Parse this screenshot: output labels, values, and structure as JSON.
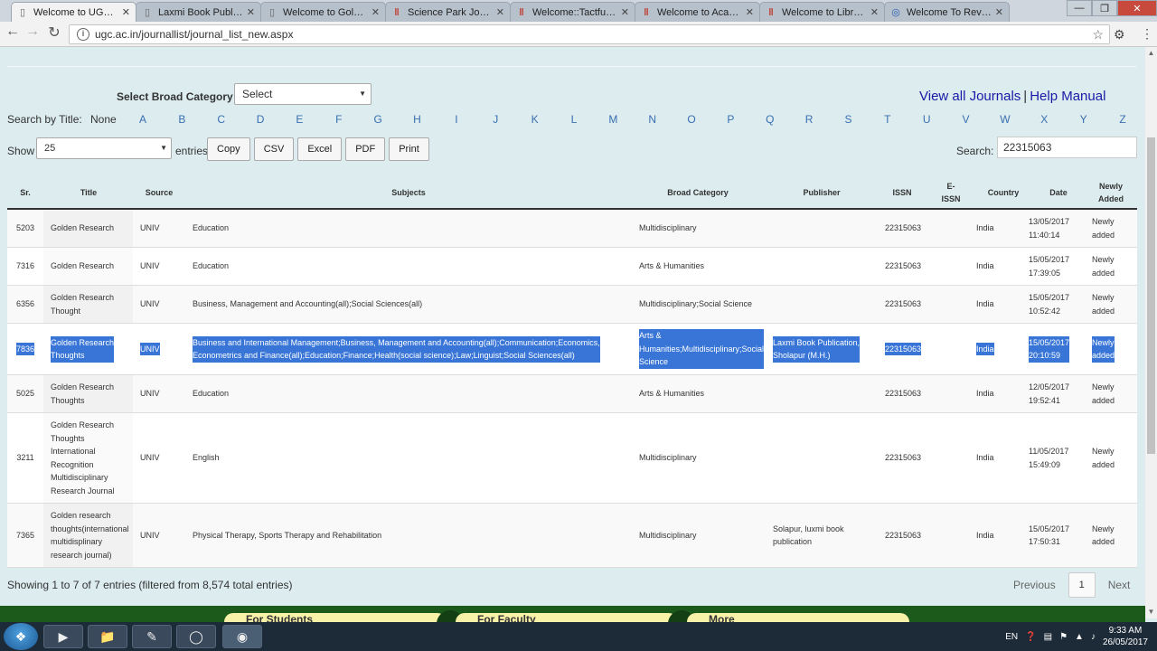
{
  "browser": {
    "tabs": [
      {
        "title": "Welcome to UGC, Ne",
        "favicon": "page-icon",
        "active": true
      },
      {
        "title": "Laxmi Book Publicatio",
        "favicon": "page-icon",
        "active": false
      },
      {
        "title": "Welcome to Golden F",
        "favicon": "page-icon",
        "active": false
      },
      {
        "title": "Science Park Journal",
        "favicon": "bars-icon",
        "active": false
      },
      {
        "title": "Welcome::Tactful Ma",
        "favicon": "bars-icon",
        "active": false
      },
      {
        "title": "Welcome to Academ",
        "favicon": "bars-icon",
        "active": false
      },
      {
        "title": "Welcome to Library S",
        "favicon": "bars-icon",
        "active": false
      },
      {
        "title": "Welcome To Review",
        "favicon": "globe-icon",
        "active": false
      }
    ],
    "url": "ugc.ac.in/journallist/journal_list_new.aspx"
  },
  "filters": {
    "category_label": "Select Broad Category :",
    "category_value": "Select",
    "view_all": "View all Journals",
    "separator": "|",
    "help": "Help Manual",
    "search_by_title": "Search by Title:",
    "none": "None",
    "letters": [
      "A",
      "B",
      "C",
      "D",
      "E",
      "F",
      "G",
      "H",
      "I",
      "J",
      "K",
      "L",
      "M",
      "N",
      "O",
      "P",
      "Q",
      "R",
      "S",
      "T",
      "U",
      "V",
      "W",
      "X",
      "Y",
      "Z"
    ]
  },
  "controls": {
    "show_label": "Show",
    "show_value": "25",
    "entries_label": "entries",
    "buttons": [
      "Copy",
      "CSV",
      "Excel",
      "PDF",
      "Print"
    ],
    "search_label": "Search:",
    "search_value": "22315063"
  },
  "table": {
    "headers": [
      "Sr.",
      "Title",
      "Source",
      "Subjects",
      "Broad Category",
      "Publisher",
      "ISSN",
      "E-\nISSN",
      "Country",
      "Date",
      "Newly\nAdded"
    ],
    "rows": [
      {
        "sr": "5203",
        "title": "Golden Research",
        "source": "UNIV",
        "subjects": "Education",
        "category": "Multidisciplinary",
        "publisher": "",
        "issn": "22315063",
        "eissn": "",
        "country": "India",
        "date": "13/05/2017\n11:40:14",
        "newly": "Newly\nadded",
        "selected": false
      },
      {
        "sr": "7316",
        "title": "Golden Research",
        "source": "UNIV",
        "subjects": "Education",
        "category": "Arts & Humanities",
        "publisher": "",
        "issn": "22315063",
        "eissn": "",
        "country": "India",
        "date": "15/05/2017\n17:39:05",
        "newly": "Newly\nadded",
        "selected": false
      },
      {
        "sr": "6356",
        "title": "Golden Research\nThought",
        "source": "UNIV",
        "subjects": "Business, Management and Accounting(all);Social Sciences(all)",
        "category": "Multidisciplinary;Social Science",
        "publisher": "",
        "issn": "22315063",
        "eissn": "",
        "country": "India",
        "date": "15/05/2017\n10:52:42",
        "newly": "Newly\nadded",
        "selected": false
      },
      {
        "sr": "7836",
        "title": "Golden Research\nThoughts",
        "source": "UNIV",
        "subjects": "Business and International Management;Business, Management and Accounting(all);Communication;Economics,\nEconometrics and Finance(all);Education;Finance;Health(social science);Law;Linguist;Social Sciences(all)",
        "category": "Arts &\nHumanities;Multidisciplinary;Social\nScience",
        "publisher": "Laxmi Book Publication,\nSholapur (M.H.)",
        "issn": "22315063",
        "eissn": "",
        "country": "India",
        "date": "15/05/2017\n20:10:59",
        "newly": "Newly\nadded",
        "selected": true
      },
      {
        "sr": "5025",
        "title": "Golden Research\nThoughts",
        "source": "UNIV",
        "subjects": "Education",
        "category": "Arts & Humanities",
        "publisher": "",
        "issn": "22315063",
        "eissn": "",
        "country": "India",
        "date": "12/05/2017\n19:52:41",
        "newly": "Newly\nadded",
        "selected": false
      },
      {
        "sr": "3211",
        "title": "Golden Research\nThoughts\nInternational\nRecognition\nMultidisciplinary\nResearch Journal",
        "source": "UNIV",
        "subjects": "English",
        "category": "Multidisciplinary",
        "publisher": "",
        "issn": "22315063",
        "eissn": "",
        "country": "India",
        "date": "11/05/2017\n15:49:09",
        "newly": "Newly\nadded",
        "selected": false
      },
      {
        "sr": "7365",
        "title": "Golden research\nthoughts(international\nmultidisplinary\nresearch journal)",
        "source": "UNIV",
        "subjects": "Physical Therapy, Sports Therapy and Rehabilitation",
        "category": "Multidisciplinary",
        "publisher": "Solapur, luxmi book\npublication",
        "issn": "22315063",
        "eissn": "",
        "country": "India",
        "date": "15/05/2017\n17:50:31",
        "newly": "Newly\nadded",
        "selected": false
      }
    ]
  },
  "pagination": {
    "info": "Showing 1 to 7 of 7 entries (filtered from 8,574 total entries)",
    "previous": "Previous",
    "current": "1",
    "next": "Next"
  },
  "footer_tabs": [
    "For Students",
    "For Faculty",
    "More"
  ],
  "taskbar": {
    "language": "EN",
    "time": "9:33 AM",
    "date": "26/05/2017"
  }
}
